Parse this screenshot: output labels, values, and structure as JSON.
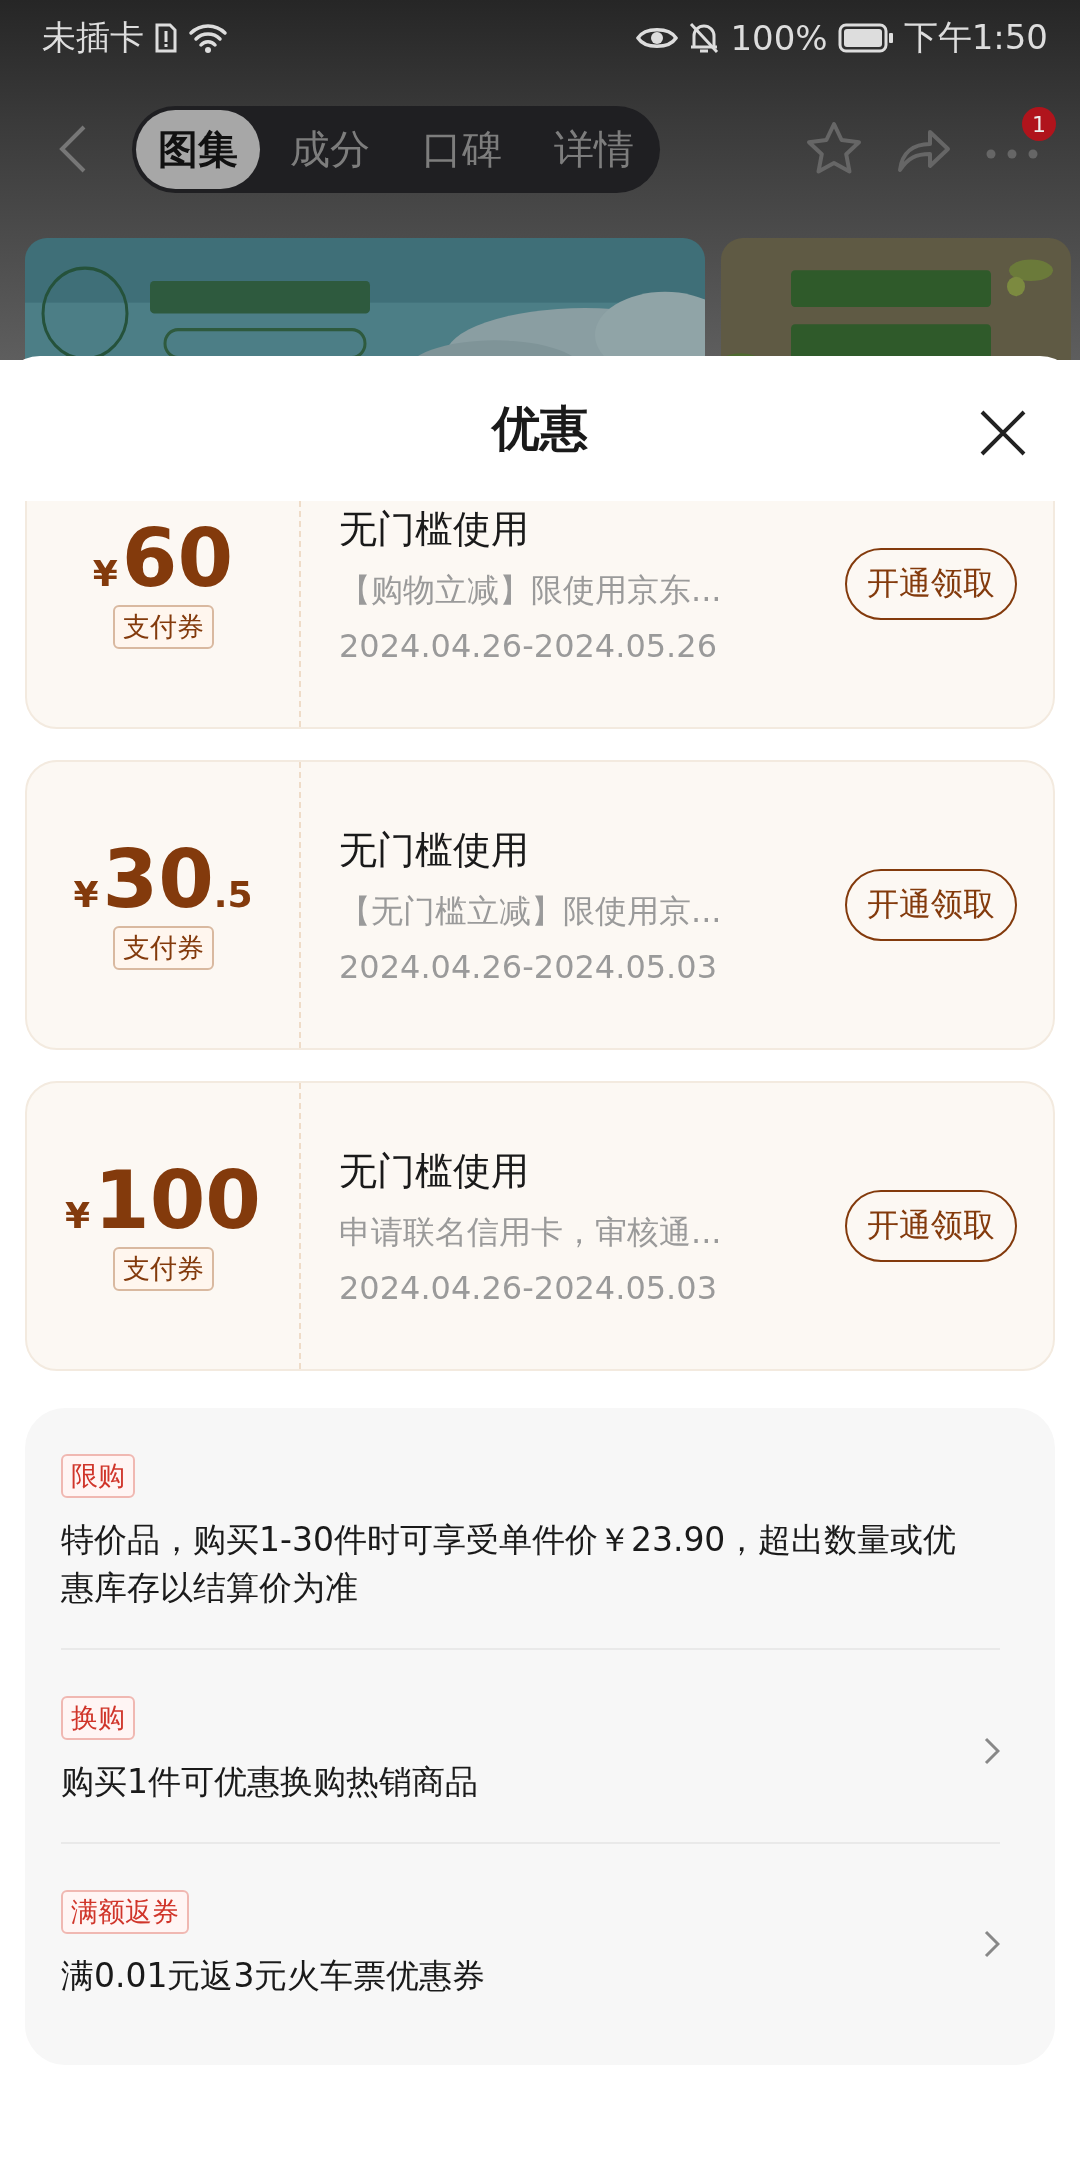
{
  "status_bar": {
    "carrier": "未插卡",
    "battery": "100%",
    "time": "下午1:50"
  },
  "nav": {
    "tabs": [
      {
        "label": "图集",
        "selected": true
      },
      {
        "label": "成分",
        "selected": false
      },
      {
        "label": "口碑",
        "selected": false
      },
      {
        "label": "详情",
        "selected": false
      }
    ],
    "more_badge": "1"
  },
  "sheet": {
    "title": "优惠",
    "coupons": [
      {
        "currency": "¥",
        "amount": "60",
        "type": "支付券",
        "title": "无门槛使用",
        "desc": "【购物立减】限使用京东...",
        "dates": "2024.04.26-2024.05.26",
        "button": "开通领取"
      },
      {
        "currency": "¥",
        "amount": "30",
        "decimal": ".5",
        "type": "支付券",
        "title": "无门槛使用",
        "desc": "【无门槛立减】限使用京...",
        "dates": "2024.04.26-2024.05.03",
        "button": "开通领取"
      },
      {
        "currency": "¥",
        "amount": "100",
        "type": "支付券",
        "title": "无门槛使用",
        "desc": "申请联名信用卡，审核通...",
        "dates": "2024.04.26-2024.05.03",
        "button": "开通领取"
      }
    ],
    "promotions": [
      {
        "tag": "限购",
        "text": "特价品，购买1-30件时可享受单件价￥23.90，超出数量或优惠库存以结算价为准",
        "expandable": false
      },
      {
        "tag": "换购",
        "text": "购买1件可优惠换购热销商品",
        "expandable": true
      },
      {
        "tag": "满额返券",
        "text": "满0.01元返3元火车票优惠券",
        "expandable": true
      }
    ]
  }
}
